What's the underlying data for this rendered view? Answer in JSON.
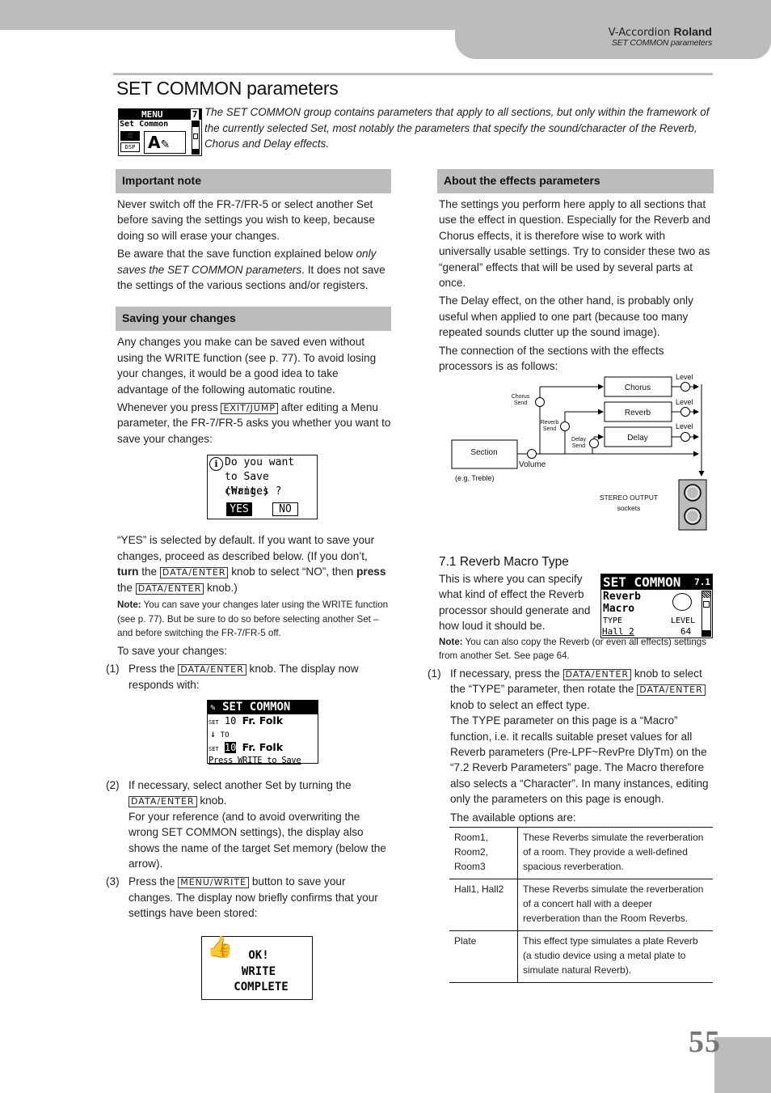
{
  "header": {
    "product": "V-Accordion",
    "brand": "Roland",
    "running_title": "SET COMMON parameters"
  },
  "page": {
    "title": "SET COMMON parameters",
    "intro": "The SET COMMON group contains parameters that apply to all sections, but only within the framework of the currently selected Set, most notably the parameters that specify the sound/character of the Reverb, Chorus and Delay effects.",
    "page_number": "55"
  },
  "menu_lcd": {
    "title": "MENU",
    "page": "7",
    "item": "Set Common",
    "icon_label": "DSP"
  },
  "important_note": {
    "heading": "Important note",
    "p1": "Never switch off the FR-7/FR-5 or select another Set before saving the settings you wish to keep, because doing so will erase your changes.",
    "p2_a": "Be aware that the save function explained below ",
    "p2_em": "only saves the SET COMMON parameters",
    "p2_b": ". It does not save the settings of the various sections and/or registers."
  },
  "saving": {
    "heading": "Saving your changes",
    "p1": "Any changes you make can be saved even without using the WRITE function (see p. 77). To avoid losing your changes, it would be a good idea to take advantage of the following automatic routine.",
    "p2_a": "Whenever you press ",
    "p2_key": "EXIT/JUMP",
    "p2_b": " after editing a Menu parameter, the FR-7/FR-5 asks you whether you want to save your changes:",
    "dialog": {
      "line1": "Do you want",
      "line2": "to Save (Write)",
      "line3": "changes ?",
      "yes": "YES",
      "no": "NO"
    },
    "p3_a": "“YES” is selected by default. If you want to save your changes, proceed as described below. (If you don’t, ",
    "p3_turn": "turn",
    "p3_b": " the ",
    "p3_key1": "DATA/ENTER",
    "p3_c": " knob to select “NO”, then ",
    "p3_press": "press",
    "p3_d": " the ",
    "p3_key2": "DATA/ENTER",
    "p3_e": " knob.)",
    "note_label": "Note:",
    "note_text": " You can save your changes later using the WRITE function (see p. 77). But be sure to do so before selecting another Set – and before switching the FR-7/FR-5 off.",
    "to_save": "To save your changes:",
    "step1_num": "(1)",
    "step1_a": "Press the ",
    "step1_key": "DATA/ENTER",
    "step1_b": " knob. The display now responds with:",
    "set_lcd": {
      "title": "SET COMMON",
      "set_label": "SET",
      "src_num": "10",
      "src_name": "Fr. Folk",
      "to": "TO",
      "dst_num": "10",
      "dst_name": "Fr. Folk",
      "footer": "Press WRITE to Save"
    },
    "step2_num": "(2)",
    "step2_a": "If necessary, select another Set by turning the ",
    "step2_key": "DATA/ENTER",
    "step2_b": " knob.",
    "step2_c": "For your reference (and to avoid overwriting the wrong SET COMMON settings), the display also shows the name of the target Set memory (below the arrow).",
    "step3_num": "(3)",
    "step3_a": "Press the ",
    "step3_key": "MENU/WRITE",
    "step3_b": " button to save your changes. The display now briefly confirms that your settings have been stored:",
    "ok_lcd": {
      "line1": "OK!",
      "line2": "WRITE",
      "line3": "COMPLETE"
    }
  },
  "effects": {
    "heading": "About the effects parameters",
    "p1": "The settings you perform here apply to all sections that use the effect in question. Especially for the Reverb and Chorus effects, it is therefore wise to work with universally usable settings. Try to consider these two as “general” effects that will be used by several parts at once.",
    "p2": "The Delay effect, on the other hand, is probably only useful when applied to one part (because too many repeated sounds clutter up the sound image).",
    "p3": "The connection of the sections with the effects processors is as follows:",
    "diagram": {
      "section": "Section",
      "section_example": "(e.g. Treble)",
      "volume": "Volume",
      "chorus_send_1": "Chorus",
      "chorus_send_2": "Send",
      "reverb_send_1": "Reverb",
      "reverb_send_2": "Send",
      "delay_send_1": "Delay",
      "delay_send_2": "Send",
      "chorus": "Chorus",
      "reverb": "Reverb",
      "delay": "Delay",
      "level": "Level",
      "output_1": "STEREO OUTPUT",
      "output_2": "sockets"
    }
  },
  "reverb_macro": {
    "heading": "7.1 Reverb Macro Type",
    "p1": "This is where you can specify what kind of effect the Reverb processor should generate and how loud it should be.",
    "note_label": "Note:",
    "note_text": " You can also copy the Reverb (or even all effects) settings from another Set. See page 64.",
    "lcd": {
      "title": "SET COMMON",
      "page": "7.1",
      "line1": "Reverb",
      "line2": "Macro",
      "type_label": "TYPE",
      "level_label": "LEVEL",
      "type_value": "Hall 2",
      "level_value": "64"
    },
    "step1_num": "(1)",
    "step1_a": "If necessary, press the ",
    "step1_key1": "DATA/ENTER",
    "step1_b": " knob to select the “TYPE” parameter, then rotate the ",
    "step1_key2": "DATA/ENTER",
    "step1_c": " knob to select an effect type.",
    "step1_d": "The TYPE parameter on this page is a “Macro” function, i.e. it recalls suitable preset values for all Reverb parameters (Pre-LPF~RevPre DlyTm) on the “7.2 Reverb Parameters” page. The Macro therefore also selects a “Character”. In many instances, editing only the parameters on this page is enough.",
    "options_intro": "The available options are:",
    "options": [
      {
        "name": "Room1, Room2, Room3",
        "desc": "These Reverbs simulate the reverberation of a room. They provide a well-defined spacious reverberation."
      },
      {
        "name": "Hall1, Hall2",
        "desc": "These Reverbs simulate the reverberation of a concert hall with a deeper reverberation than the Room Reverbs."
      },
      {
        "name": "Plate",
        "desc": "This effect type simulates a plate Reverb (a studio device using a metal plate to simulate natural Reverb)."
      }
    ]
  }
}
